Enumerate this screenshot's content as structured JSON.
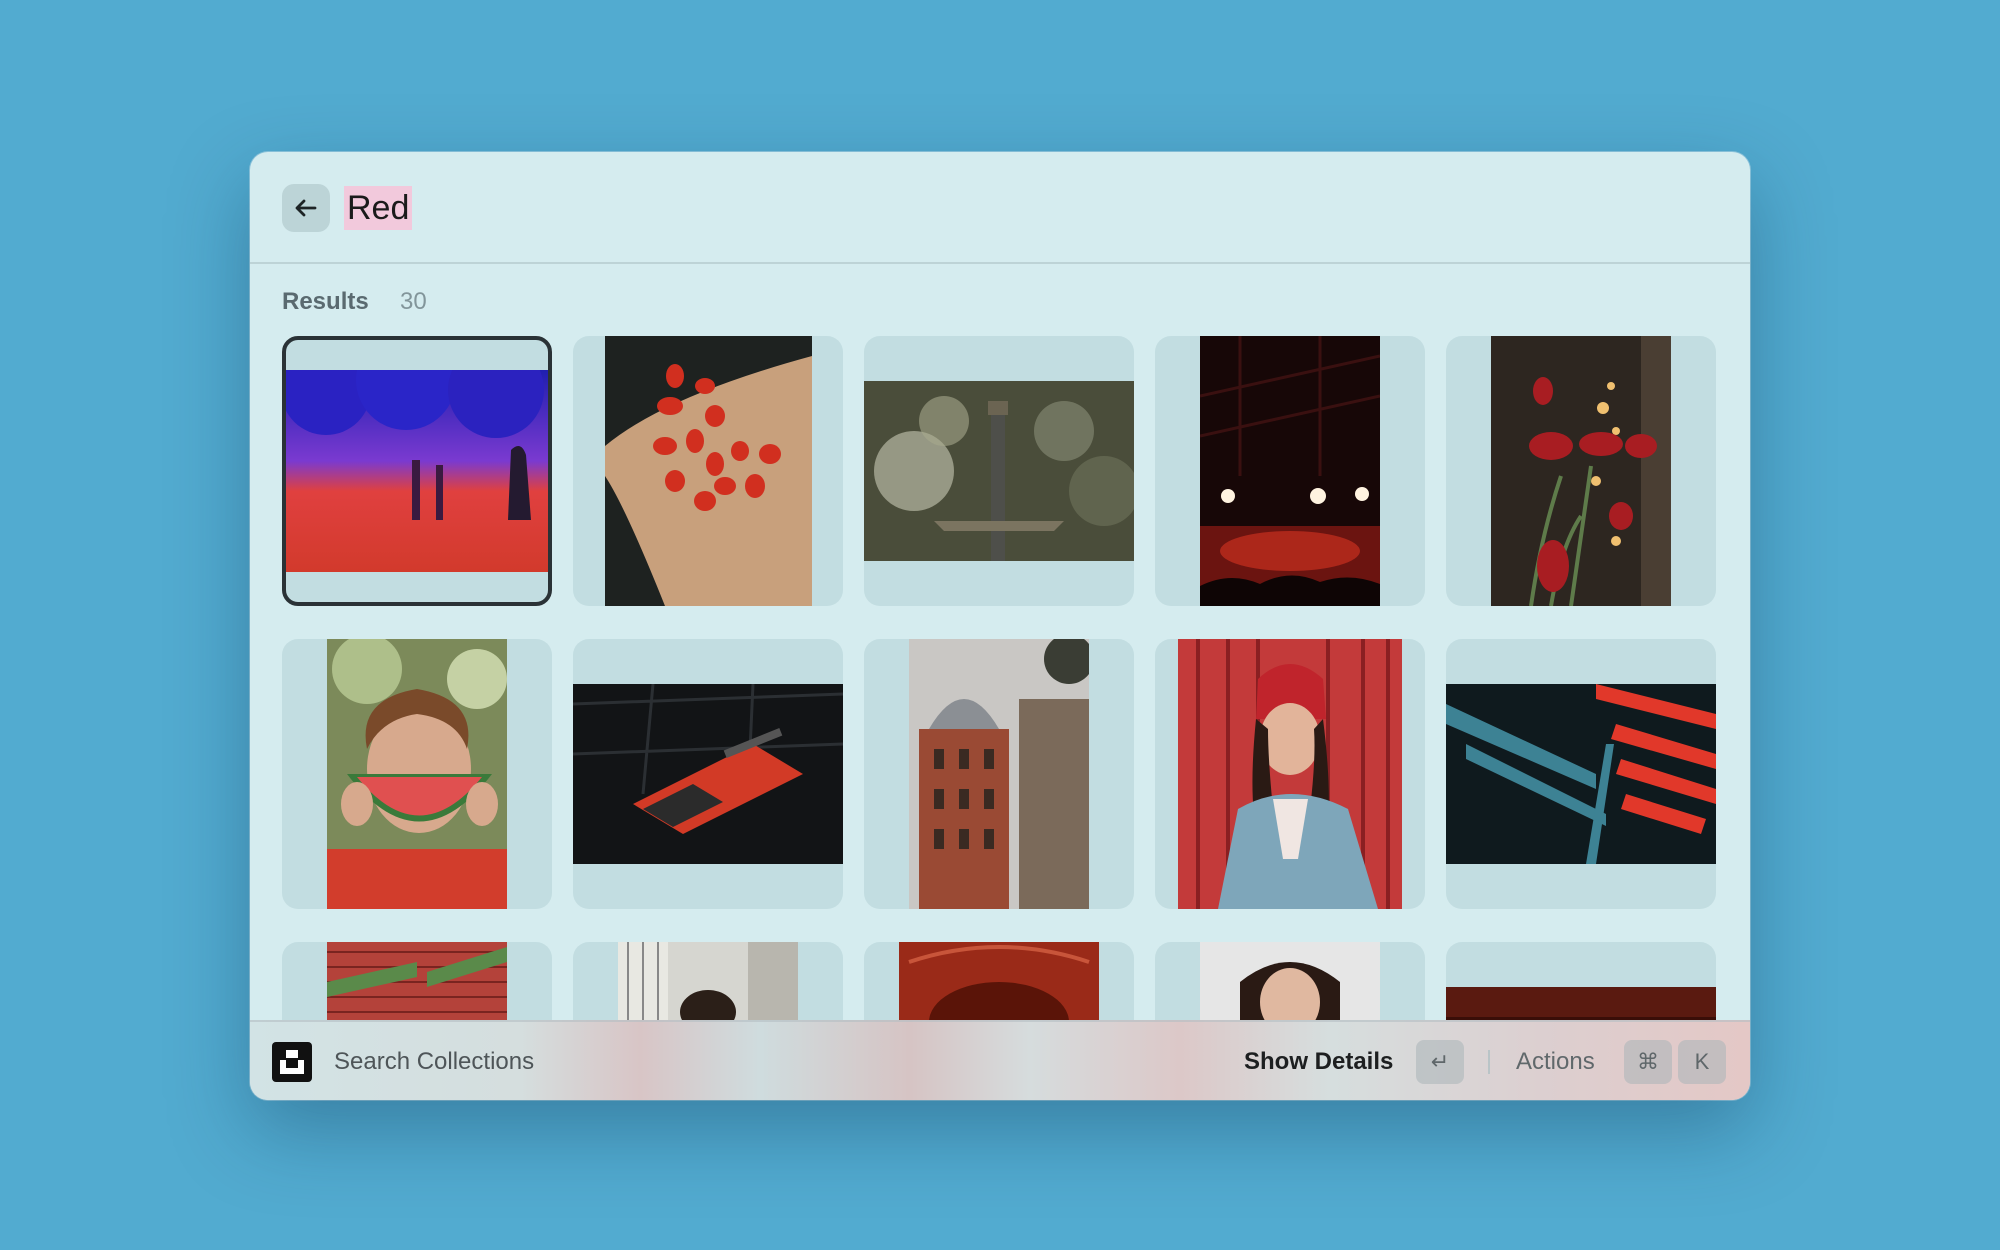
{
  "search": {
    "query": "Red"
  },
  "results": {
    "label": "Results",
    "count": "30"
  },
  "footer": {
    "command_label": "Search Collections",
    "primary_action": "Show Details",
    "enter_key": "↵",
    "actions_label": "Actions",
    "cmd_key": "⌘",
    "k_key": "K"
  },
  "icons": {
    "back": "arrow-left-icon",
    "logo": "app-logo-icon"
  },
  "colors": {
    "background": "#52abd0",
    "window": "#d5ecef",
    "highlight": "#f2c9dc",
    "tile": "#c2dde1"
  }
}
